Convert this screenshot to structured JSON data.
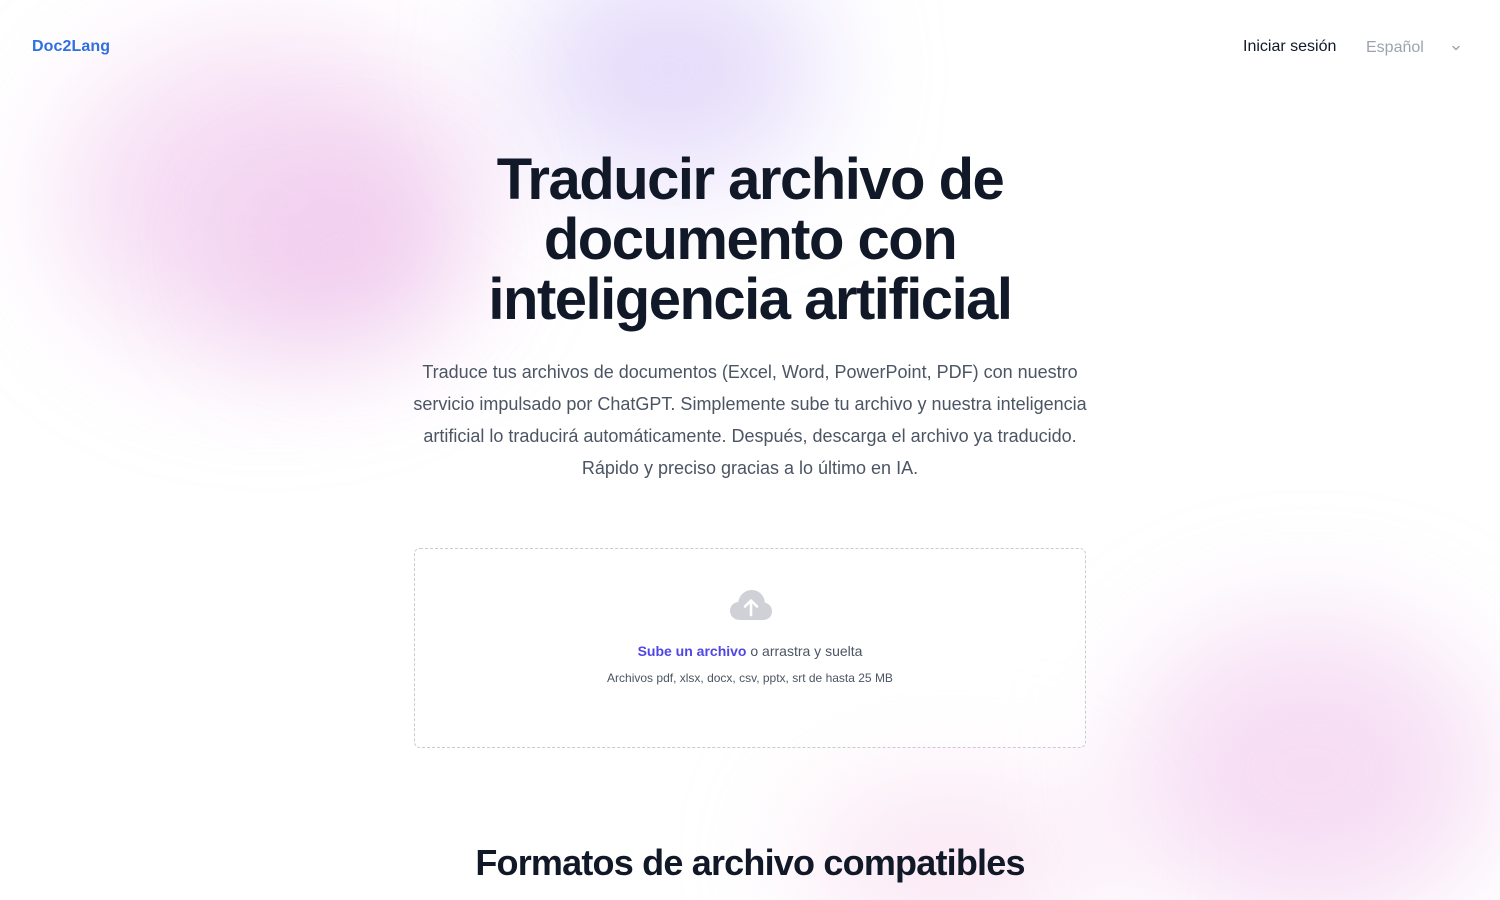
{
  "header": {
    "logo": "Doc2Lang",
    "login": "Iniciar sesión",
    "language": "Español"
  },
  "hero": {
    "title": "Traducir archivo de documento con inteligencia artificial",
    "description": "Traduce tus archivos de documentos (Excel, Word, PowerPoint, PDF) con nuestro servicio impulsado por ChatGPT. Simplemente sube tu archivo y nuestra inteligencia artificial lo traducirá automáticamente. Después, descarga el archivo ya traducido. Rápido y preciso gracias a lo último en IA."
  },
  "upload": {
    "icon": "cloud-upload-icon",
    "link_label": "Sube un archivo",
    "rest_label": " o arrastra y suelta",
    "hint": "Archivos pdf, xlsx, docx, csv, pptx, srt de hasta 25 MB"
  },
  "sections": {
    "formats_title": "Formatos de archivo compatibles"
  },
  "colors": {
    "brand": "#2f6fe0",
    "accent": "#4f46e5",
    "heading": "#111827",
    "muted": "#4b5563"
  }
}
